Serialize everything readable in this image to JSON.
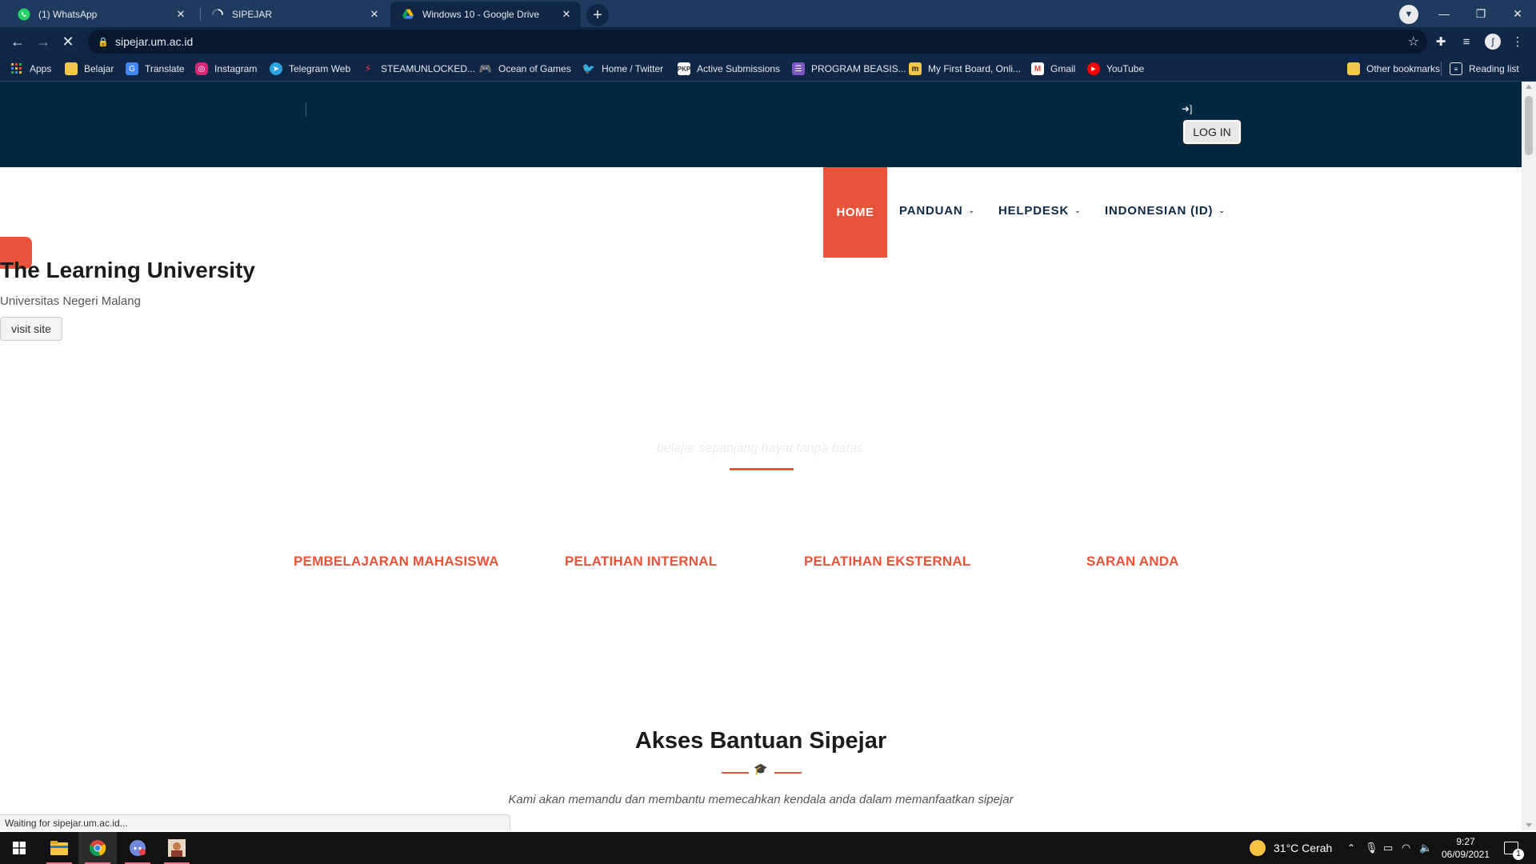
{
  "tabs": [
    {
      "title": "(1) WhatsApp",
      "icon": "whatsapp-icon"
    },
    {
      "title": "SIPEJAR",
      "icon": "loading-spinner-icon"
    },
    {
      "title": "Windows 10 - Google Drive",
      "icon": "google-drive-icon"
    }
  ],
  "address": {
    "url": "sipejar.um.ac.id"
  },
  "bookmarks": {
    "items": [
      "Apps",
      "Belajar",
      "Translate",
      "Instagram",
      "Telegram Web",
      "STEAMUNLOCKED...",
      "Ocean of Games",
      "Home / Twitter",
      "Active Submissions",
      "PROGRAM BEASIS...",
      "My First Board, Onli...",
      "Gmail",
      "YouTube"
    ],
    "other": "Other bookmarks",
    "reading_list": "Reading list"
  },
  "header": {
    "login": "LOG IN"
  },
  "nav": {
    "home": "HOME",
    "panduan": "PANDUAN",
    "helpdesk": "HELPDESK",
    "language": "INDONESIAN (ID)"
  },
  "hero": {
    "title": "The Learning University",
    "subtitle": "Universitas Negeri Malang",
    "button": "visit site"
  },
  "tagline": "belajar sepanjang hayat tanpa batas",
  "services": [
    "PEMBELAJARAN MAHASISWA",
    "PELATIHAN INTERNAL",
    "PELATIHAN EKSTERNAL",
    "SARAN ANDA"
  ],
  "akses": {
    "title": "Akses Bantuan Sipejar",
    "description": "Kami akan memandu dan membantu memecahkan kendala anda dalam memanfaatkan sipejar"
  },
  "status": "Waiting for sipejar.um.ac.id...",
  "taskbar": {
    "weather": "31°C  Cerah",
    "time": "9:27",
    "date": "06/09/2021",
    "notification_count": "1"
  },
  "colors": {
    "accent": "#e8533a",
    "header_bg": "#022741",
    "nav_text": "#0e2a45"
  }
}
